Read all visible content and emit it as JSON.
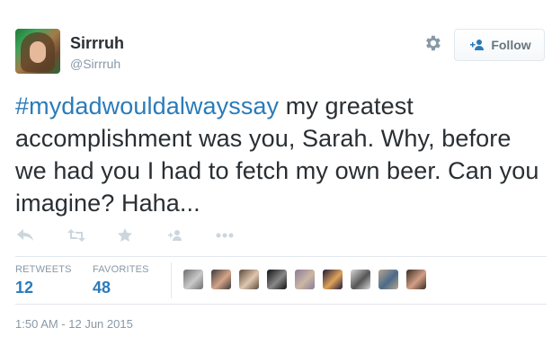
{
  "user": {
    "display_name": "Sirrruh",
    "handle": "@Sirrruh"
  },
  "follow_button": {
    "label": "Follow"
  },
  "tweet": {
    "hashtag": "#mydadwouldalwayssay",
    "text": " my greatest accomplishment was you, Sarah. Why, before we had you I had to fetch my own beer. Can you imagine? Haha..."
  },
  "actions": [
    {
      "icon": "reply-icon"
    },
    {
      "icon": "retweet-icon"
    },
    {
      "icon": "favorite-star-icon"
    },
    {
      "icon": "follow-person-icon"
    },
    {
      "icon": "more-dots-icon"
    }
  ],
  "stats": {
    "retweets_label": "RETWEETS",
    "retweets_value": "12",
    "favorites_label": "FAVORITES",
    "favorites_value": "48"
  },
  "favoriters": [
    {
      "colors": [
        "#6d6d6d",
        "#c9c9c9"
      ]
    },
    {
      "colors": [
        "#3a3a3a",
        "#d5a48a"
      ]
    },
    {
      "colors": [
        "#5a4a3a",
        "#e0c6b0"
      ]
    },
    {
      "colors": [
        "#111111",
        "#888888"
      ]
    },
    {
      "colors": [
        "#8a7a9a",
        "#cbb7a3"
      ]
    },
    {
      "colors": [
        "#1c1a3a",
        "#e0a25a"
      ]
    },
    {
      "colors": [
        "#d7d7d7",
        "#555555"
      ]
    },
    {
      "colors": [
        "#b9a58f",
        "#4a6a8a"
      ]
    },
    {
      "colors": [
        "#3a2a22",
        "#d1a085"
      ]
    }
  ],
  "timestamp": "1:50 AM - 12 Jun 2015",
  "colors": {
    "link": "#2b7bb9",
    "text": "#292f33",
    "muted": "#8899a6",
    "icon": "#ccd6dd",
    "border": "#e1e8ed"
  }
}
